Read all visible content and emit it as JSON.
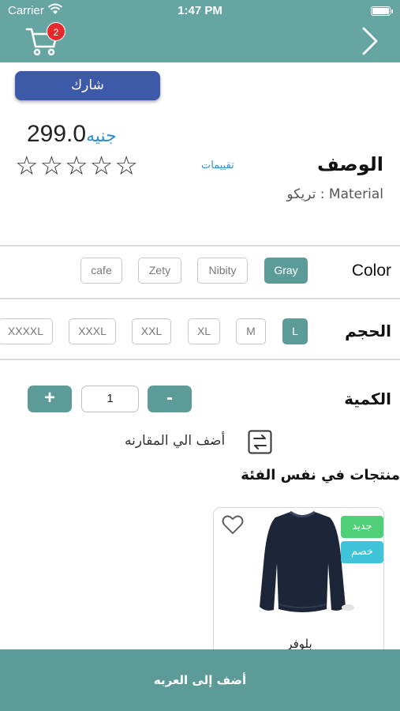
{
  "status_bar": {
    "carrier": "Carrier",
    "time": "1:47 PM"
  },
  "header": {
    "cart_count": "2",
    "icons": [
      "cart-icon",
      "chevron-right-icon"
    ]
  },
  "product": {
    "share_label": "شارك",
    "price": "299.0",
    "currency": "جنيه",
    "stars": "☆☆☆☆☆",
    "rating": 0,
    "ratings_link": "تقييمات",
    "description_title": "الوصف",
    "description_text": "تريكو : Material"
  },
  "color_row": {
    "label": "Color",
    "options": [
      "Gray",
      "Nibity",
      "Zety",
      "cafe"
    ],
    "selected": "Gray"
  },
  "size_row": {
    "label": "الحجم",
    "options": [
      "L",
      "M",
      "XL",
      "XXL",
      "XXXL",
      "XXXXL"
    ],
    "selected": "L"
  },
  "quantity": {
    "label": "الكمية",
    "value": "1",
    "minus": "-",
    "plus": "+"
  },
  "compare": {
    "label": "أضف الي المقارنه",
    "icon": "compare-icon"
  },
  "related": {
    "title": "منتجات في نفس الفئة",
    "items": [
      {
        "name": "بلوفر",
        "badge_new": "جديد",
        "badge_sale": "خصم"
      }
    ]
  },
  "add_to_cart": "أضف إلى العربه",
  "colors": {
    "primary": "#66a5a2",
    "button": "#5d9b98",
    "share": "#3d5aa8",
    "badge_red": "#e8292c",
    "link": "#2a8fd8"
  }
}
